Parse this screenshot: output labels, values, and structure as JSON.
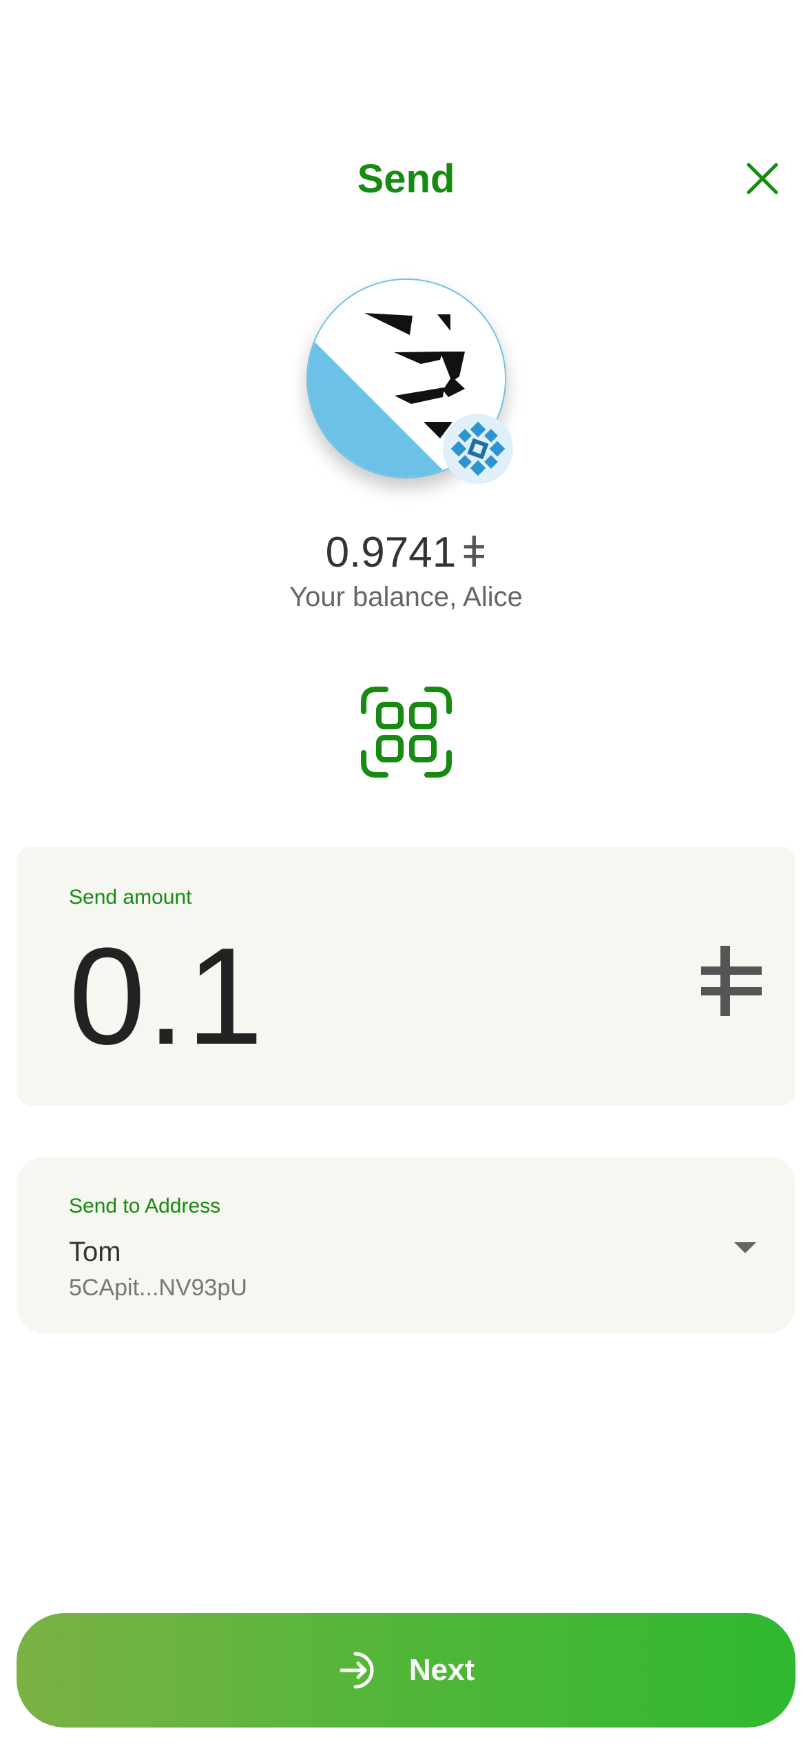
{
  "header": {
    "title": "Send",
    "close_icon": "close-icon"
  },
  "account": {
    "avatar_icon": "identicon-avatar",
    "network_badge_icon": "network-badge-icon",
    "balance_value": "0.9741",
    "balance_unit": "ǂ",
    "balance_label": "Your balance, Alice"
  },
  "scan": {
    "icon": "qr-scan-icon"
  },
  "amount": {
    "label": "Send amount",
    "value": "0.1",
    "unit_icon": "currency-unit-icon"
  },
  "address": {
    "label": "Send to Address",
    "name": "Tom",
    "address_short": "5CApit...NV93pU",
    "dropdown_icon": "chevron-down-icon"
  },
  "footer": {
    "next_label": "Next",
    "next_icon": "arrow-login-icon"
  },
  "colors": {
    "accent": "#178a12",
    "card_bg": "#f6f7f0",
    "avatar_blue": "#6cc1e6",
    "button_start": "#7bb243",
    "button_end": "#2fb830"
  }
}
